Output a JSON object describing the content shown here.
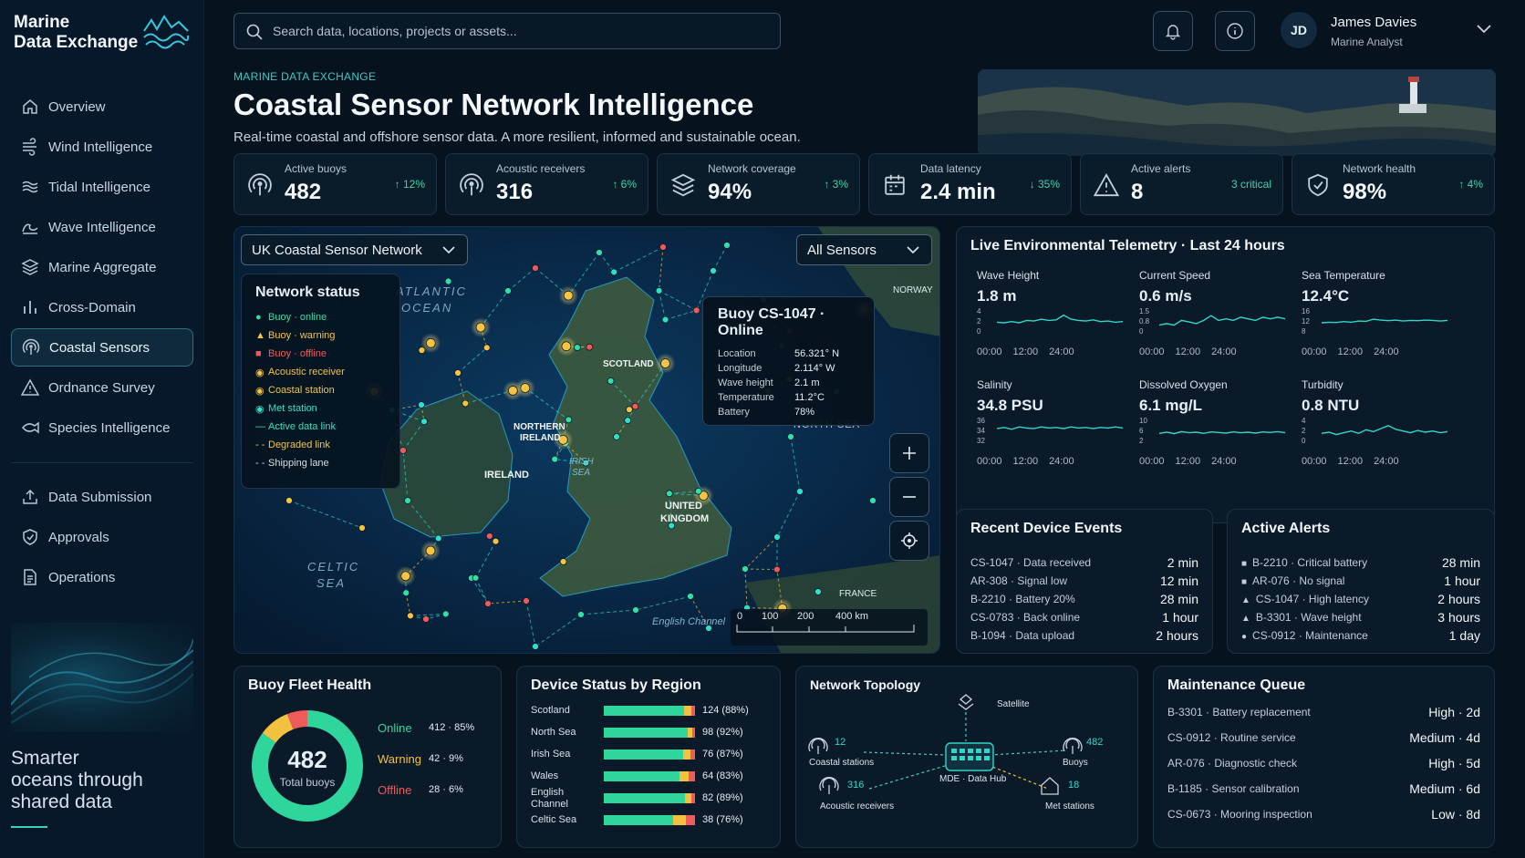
{
  "brand": {
    "line1": "Marine",
    "line2": "Data Exchange"
  },
  "sidebar": {
    "items": [
      {
        "label": "Overview",
        "icon": "home-icon"
      },
      {
        "label": "Wind Intelligence",
        "icon": "wind-icon"
      },
      {
        "label": "Tidal Intelligence",
        "icon": "tide-icon"
      },
      {
        "label": "Wave Intelligence",
        "icon": "wave-icon"
      },
      {
        "label": "Marine Aggregate",
        "icon": "layers-icon"
      },
      {
        "label": "Cross-Domain",
        "icon": "bars-icon"
      },
      {
        "label": "Coastal Sensors",
        "icon": "antenna-icon",
        "active": true
      },
      {
        "label": "Ordnance Survey",
        "icon": "warning-icon"
      },
      {
        "label": "Species Intelligence",
        "icon": "fish-icon"
      }
    ],
    "secondary": [
      {
        "label": "Data Submission",
        "icon": "upload-icon"
      },
      {
        "label": "Approvals",
        "icon": "shield-check-icon"
      },
      {
        "label": "Operations",
        "icon": "document-icon"
      }
    ],
    "tagline": [
      "Smarter",
      "oceans through",
      "shared data"
    ]
  },
  "search": {
    "placeholder": "Search data, locations, projects or assets..."
  },
  "user": {
    "initials": "JD",
    "name": "James Davies",
    "role": "Marine Analyst"
  },
  "header": {
    "eyebrow": "MARINE DATA EXCHANGE",
    "title": "Coastal Sensor Network Intelligence",
    "subtitle": "Real-time coastal and offshore sensor data. A more resilient, informed and sustainable ocean."
  },
  "kpis": [
    {
      "label": "Active buoys",
      "value": "482",
      "delta": "↑ 12%",
      "icon": "antenna-icon"
    },
    {
      "label": "Acoustic receivers",
      "value": "316",
      "delta": "↑ 6%",
      "icon": "antenna-icon"
    },
    {
      "label": "Network coverage",
      "value": "94%",
      "delta": "↑ 3%",
      "icon": "layers-icon"
    },
    {
      "label": "Data latency",
      "value": "2.4 min",
      "delta": "↓ 35%",
      "icon": "calendar-icon"
    },
    {
      "label": "Active alerts",
      "value": "8",
      "delta": "3 critical",
      "icon": "warning-icon"
    },
    {
      "label": "Network health",
      "value": "98%",
      "delta": "↑ 4%",
      "icon": "shield-check-icon"
    }
  ],
  "map": {
    "network_select": "UK Coastal Sensor Network",
    "sensor_select": "All Sensors",
    "labels": {
      "atlantic": "ATLANTIC",
      "ocean": "OCEAN",
      "norway": "NORWAY",
      "scotland": "SCOTLAND",
      "ni1": "NORTHERN",
      "ni2": "IRELAND",
      "ireland": "IRELAND",
      "irish1": "IRISH",
      "irish2": "SEA",
      "uk1": "UNITED",
      "uk2": "KINGDOM",
      "celtic1": "CELTIC",
      "celtic2": "SEA",
      "france": "FRANCE",
      "channel": "English Channel",
      "north_sea": "NORTH SEA"
    },
    "legend": {
      "title": "Network status",
      "items": [
        {
          "label": "Buoy · online",
          "color": "#2fe0a8",
          "sym": "●"
        },
        {
          "label": "Buoy · warning",
          "color": "#f5c542",
          "sym": "▲"
        },
        {
          "label": "Buoy · offline",
          "color": "#f05a5a",
          "sym": "■"
        },
        {
          "label": "Acoustic receiver",
          "color": "#f5c542",
          "sym": "◉"
        },
        {
          "label": "Coastal station",
          "color": "#f5c542",
          "sym": "◉"
        },
        {
          "label": "Met station",
          "color": "#2fe0c8",
          "sym": "◉"
        },
        {
          "label": "Active data link",
          "color": "#2fe0c8",
          "sym": "—"
        },
        {
          "label": "Degraded link",
          "color": "#f5c542",
          "sym": "- -"
        },
        {
          "label": "Shipping lane",
          "color": "#c8d2dc",
          "sym": "- -"
        }
      ]
    },
    "tooltip": {
      "title": "Buoy CS-1047 · Online",
      "rows": [
        {
          "k": "Location",
          "v": "56.321° N"
        },
        {
          "k": "Longitude",
          "v": "2.114° W"
        },
        {
          "k": "Wave height",
          "v": "2.1 m"
        },
        {
          "k": "Temperature",
          "v": "11.2°C"
        },
        {
          "k": "Battery",
          "v": "78%"
        }
      ]
    },
    "scale": [
      "0",
      "100",
      "200",
      "400 km"
    ]
  },
  "telemetry": {
    "title": "Live Environmental Telemetry · Last 24 hours",
    "metrics": [
      {
        "label": "Wave Height",
        "value": "1.8 m",
        "ticks": [
          "4",
          "2",
          "0"
        ],
        "x": [
          "00:00",
          "12:00",
          "24:00"
        ],
        "series": [
          2.1,
          2.0,
          2.2,
          2.0,
          2.4,
          2.3,
          2.6,
          2.4,
          2.5,
          3.3,
          2.6,
          2.4,
          2.3,
          2.5,
          2.2,
          2.3,
          2.1,
          2.2
        ]
      },
      {
        "label": "Current Speed",
        "value": "0.6 m/s",
        "ticks": [
          "1.5",
          "0.8",
          "0"
        ],
        "x": [
          "00:00",
          "12:00",
          "24:00"
        ],
        "series": [
          0.6,
          0.7,
          0.6,
          0.9,
          0.8,
          0.7,
          0.9,
          1.2,
          0.9,
          1.0,
          0.9,
          1.1,
          1.0,
          0.9,
          1.1,
          1.0,
          1.1,
          1.0
        ]
      },
      {
        "label": "Sea Temperature",
        "value": "12.4°C",
        "ticks": [
          "16",
          "12",
          "8"
        ],
        "x": [
          "00:00",
          "12:00",
          "24:00"
        ],
        "series": [
          12.0,
          12.2,
          12.1,
          12.4,
          12.2,
          12.6,
          12.5,
          13.2,
          12.9,
          12.7,
          12.9,
          12.6,
          12.8,
          12.7,
          12.9,
          12.8,
          12.6,
          12.8
        ]
      },
      {
        "label": "Salinity",
        "value": "34.8 PSU",
        "ticks": [
          "36",
          "34",
          "32"
        ],
        "x": [
          "00:00",
          "12:00",
          "24:00"
        ],
        "series": [
          34.6,
          34.8,
          34.5,
          34.9,
          34.7,
          34.6,
          34.9,
          34.7,
          34.8,
          34.6,
          34.9,
          34.7,
          34.8,
          34.6,
          34.8,
          34.7,
          34.9,
          34.7
        ]
      },
      {
        "label": "Dissolved Oxygen",
        "value": "6.1 mg/L",
        "ticks": [
          "10",
          "6",
          "2"
        ],
        "x": [
          "00:00",
          "12:00",
          "24:00"
        ],
        "series": [
          5.6,
          6.0,
          5.5,
          6.2,
          5.8,
          6.0,
          5.6,
          6.1,
          5.9,
          5.7,
          6.1,
          5.8,
          6.0,
          5.7,
          6.1,
          5.9,
          6.2,
          5.8
        ]
      },
      {
        "label": "Turbidity",
        "value": "0.8 NTU",
        "ticks": [
          "4",
          "2",
          "0"
        ],
        "x": [
          "00:00",
          "12:00",
          "24:00"
        ],
        "series": [
          1.8,
          2.0,
          1.6,
          1.9,
          2.2,
          1.8,
          2.4,
          2.1,
          2.6,
          3.1,
          2.5,
          2.2,
          1.9,
          2.3,
          2.0,
          2.2,
          1.9,
          2.1
        ]
      }
    ]
  },
  "events": {
    "title": "Recent Device Events",
    "rows": [
      {
        "l": "CS-1047 · Data received",
        "r": "2 min"
      },
      {
        "l": "AR-308 · Signal low",
        "r": "12 min"
      },
      {
        "l": "B-2210 · Battery 20%",
        "r": "28 min"
      },
      {
        "l": "CS-0783 · Back online",
        "r": "1 hour"
      },
      {
        "l": "B-1094 · Data upload",
        "r": "2 hours"
      }
    ]
  },
  "alerts": {
    "title": "Active Alerts",
    "rows": [
      {
        "sym": "■",
        "l": "B-2210 · Critical battery",
        "r": "28 min"
      },
      {
        "sym": "■",
        "l": "AR-076 · No signal",
        "r": "1 hour"
      },
      {
        "sym": "▲",
        "l": "CS-1047 · High latency",
        "r": "2 hours"
      },
      {
        "sym": "▲",
        "l": "B-3301 · Wave height",
        "r": "3 hours"
      },
      {
        "sym": "●",
        "l": "CS-0912 · Maintenance",
        "r": "1 day"
      }
    ]
  },
  "fleet": {
    "title": "Buoy Fleet Health",
    "total": "482",
    "total_label": "Total buoys",
    "segments": [
      {
        "label": "Online",
        "value": "412 · 85%",
        "frac": 0.85,
        "color": "#2fd69c"
      },
      {
        "label": "Warning",
        "value": "42 · 9%",
        "frac": 0.09,
        "color": "#f2c23e"
      },
      {
        "label": "Offline",
        "value": "28 · 6%",
        "frac": 0.06,
        "color": "#ee5b5b"
      }
    ]
  },
  "regions": {
    "title": "Device Status by Region",
    "rows": [
      {
        "name": "Scotland",
        "value": "124 (88%)",
        "online": 0.88,
        "warning": 0.08
      },
      {
        "name": "North Sea",
        "value": "98 (92%)",
        "online": 0.92,
        "warning": 0.05
      },
      {
        "name": "Irish Sea",
        "value": "76 (87%)",
        "online": 0.87,
        "warning": 0.08
      },
      {
        "name": "Wales",
        "value": "64 (83%)",
        "online": 0.83,
        "warning": 0.1
      },
      {
        "name": "English\nChannel",
        "value": "82 (89%)",
        "online": 0.89,
        "warning": 0.07
      },
      {
        "name": "Celtic Sea",
        "value": "38 (76%)",
        "online": 0.76,
        "warning": 0.14
      }
    ]
  },
  "topology": {
    "title": "Network Topology",
    "hub": "MDE · Data Hub",
    "satellite": "Satellite",
    "nodes": [
      {
        "label": "Coastal stations",
        "count": "12"
      },
      {
        "label": "Acoustic receivers",
        "count": "316"
      },
      {
        "label": "Buoys",
        "count": "482"
      },
      {
        "label": "Met stations",
        "count": "18"
      }
    ]
  },
  "maintenance": {
    "title": "Maintenance Queue",
    "rows": [
      {
        "l": "B-3301 · Battery replacement",
        "r": "High · 2d"
      },
      {
        "l": "CS-0912 · Routine service",
        "r": "Medium · 4d"
      },
      {
        "l": "AR-076 · Diagnostic check",
        "r": "High · 5d"
      },
      {
        "l": "B-1185 · Sensor calibration",
        "r": "Medium · 6d"
      },
      {
        "l": "CS-0673 · Mooring inspection",
        "r": "Low · 8d"
      }
    ]
  }
}
